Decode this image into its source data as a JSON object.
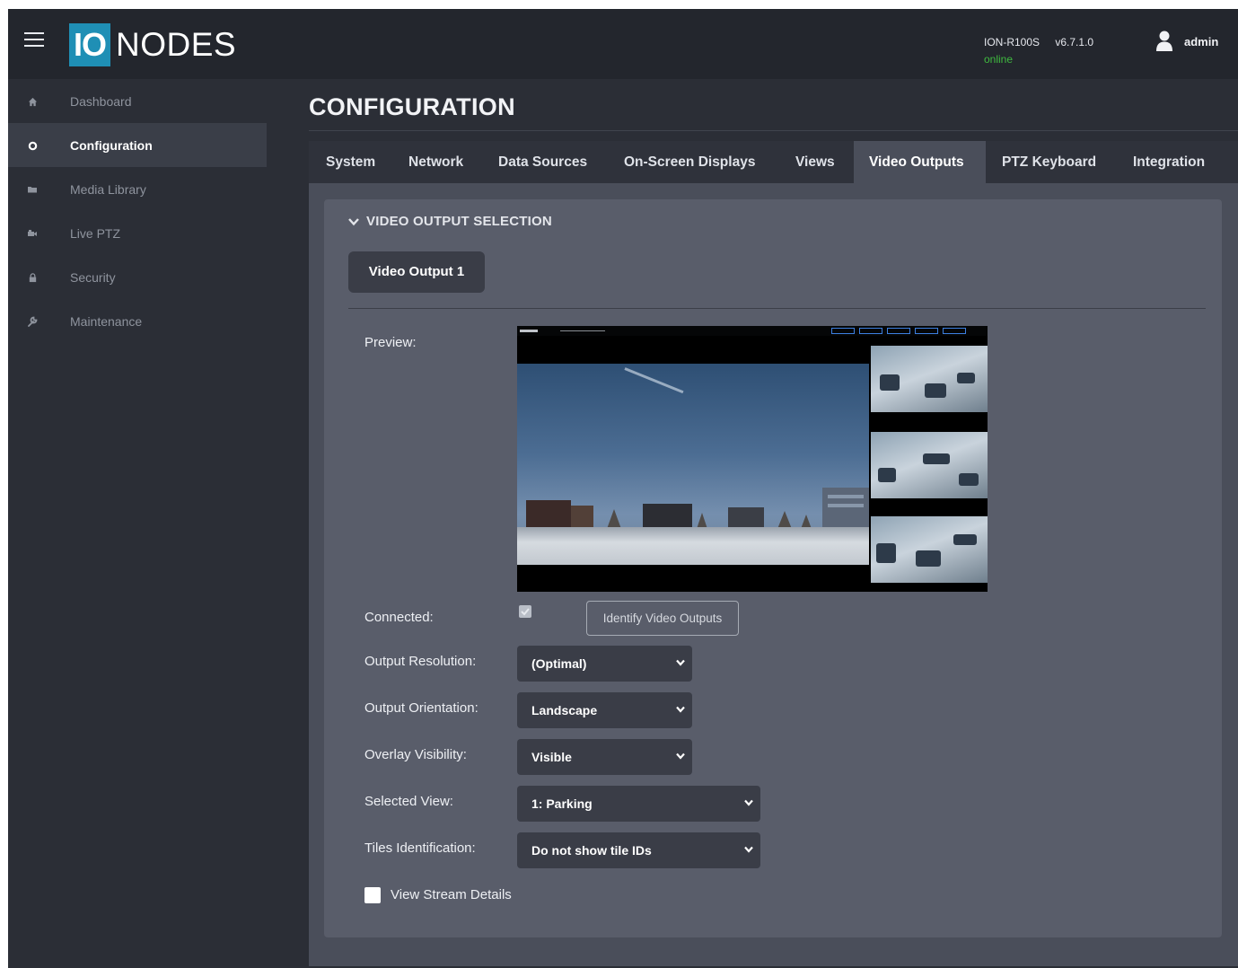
{
  "header": {
    "logo_io": "IO",
    "logo_nodes": "NODES",
    "device_name": "ION-R100S",
    "version": "v6.7.1.0",
    "status": "online",
    "user": "admin",
    "status_color": "#3fb93f",
    "brand_color": "#1f8fb5"
  },
  "sidebar": {
    "items": [
      {
        "label": "Dashboard",
        "icon": "home-icon"
      },
      {
        "label": "Configuration",
        "icon": "gear-icon"
      },
      {
        "label": "Media Library",
        "icon": "folder-icon"
      },
      {
        "label": "Live PTZ",
        "icon": "video-camera-icon"
      },
      {
        "label": "Security",
        "icon": "lock-icon"
      },
      {
        "label": "Maintenance",
        "icon": "wrench-icon"
      }
    ]
  },
  "main": {
    "title": "CONFIGURATION",
    "tabs": [
      "System",
      "Network",
      "Data Sources",
      "On-Screen Displays",
      "Views",
      "Video Outputs",
      "PTZ Keyboard",
      "Integration"
    ],
    "active_tab": "Video Outputs",
    "section_title": "VIDEO OUTPUT SELECTION",
    "output_tab": "Video Output 1",
    "labels": {
      "preview": "Preview:",
      "connected": "Connected:",
      "output_resolution": "Output Resolution:",
      "output_orientation": "Output Orientation:",
      "overlay_visibility": "Overlay Visibility:",
      "selected_view": "Selected View:",
      "tiles_identification": "Tiles Identification:"
    },
    "connected": true,
    "identify_button": "Identify Video Outputs",
    "selects": {
      "output_resolution": "(Optimal)",
      "output_orientation": "Landscape",
      "overlay_visibility": "Visible",
      "selected_view": "1: Parking",
      "tiles_identification": "Do not show tile IDs"
    },
    "view_stream_details": "View Stream Details",
    "view_stream_details_checked": false
  }
}
